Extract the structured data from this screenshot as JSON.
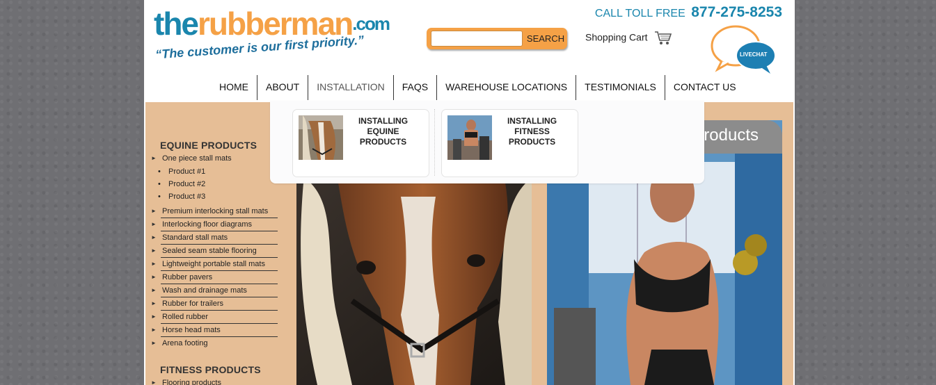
{
  "logo": {
    "part1": "the",
    "part2": "rubberman",
    "part3": ".com",
    "tagline": "“The customer is our first priority.”"
  },
  "header": {
    "tollfree_label": "CALL TOLL FREE",
    "phone": "877-275-8253",
    "search_placeholder": "",
    "search_button": "SEARCH",
    "cart_label": "Shopping Cart",
    "livechat_label": "LIVECHAT"
  },
  "nav": {
    "items": [
      {
        "label": "HOME"
      },
      {
        "label": "ABOUT"
      },
      {
        "label": "INSTALLATION"
      },
      {
        "label": "FAQS"
      },
      {
        "label": "WAREHOUSE LOCATIONS"
      },
      {
        "label": "TESTIMONIALS"
      },
      {
        "label": "CONTACT US"
      }
    ]
  },
  "dropdown": {
    "items": [
      {
        "label": "INSTALLING EQUINE PRODUCTS"
      },
      {
        "label": "INSTALLING FITNESS PRODUCTS"
      }
    ]
  },
  "sidebar": {
    "equine_heading": "EQUINE PRODUCTS",
    "first_item": "One piece stall mats",
    "subitems": [
      "Product #1",
      "Product #2",
      "Product #3"
    ],
    "items": [
      "Premium interlocking stall mats",
      "Interlocking floor diagrams",
      "Standard stall mats",
      "Sealed seam stable flooring",
      "Lightweight portable stall mats",
      "Rubber pavers",
      "Wash and drainage mats",
      "Rubber for trailers",
      "Rolled rubber",
      "Horse head mats",
      "Arena footing"
    ],
    "fitness_heading": "FITNESS PRODUCTS",
    "fitness_first_item": "Flooring products"
  },
  "banners": {
    "fitness_banner": "roducts"
  },
  "colors": {
    "brand_blue": "#1a86ad",
    "brand_orange": "#f5a146",
    "tan": "#e6be96",
    "background": "#6f6f73"
  }
}
